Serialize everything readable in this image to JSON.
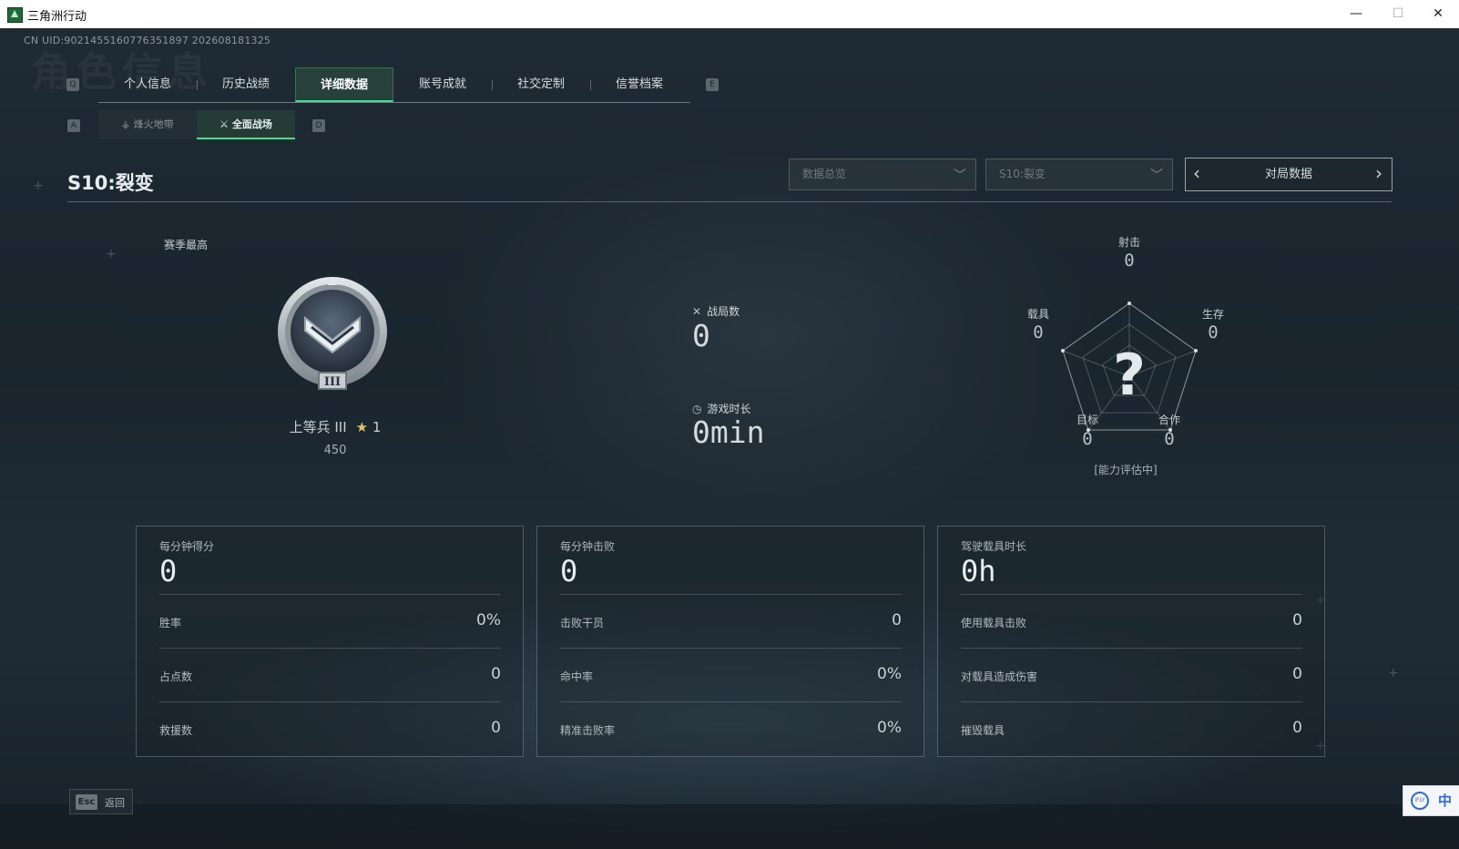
{
  "window": {
    "title": "三角洲行动",
    "minimize": "—",
    "maximize": "☐",
    "close": "✕"
  },
  "uid": "CN UID:9021455160776351897 202608181325",
  "bg_title": "角色信息",
  "tabs": {
    "key_left": "Q",
    "key_right": "E",
    "items": [
      {
        "label": "个人信息"
      },
      {
        "label": "历史战绩"
      },
      {
        "label": "详细数据",
        "active": true
      },
      {
        "label": "账号成就"
      },
      {
        "label": "社交定制"
      },
      {
        "label": "信誉档案"
      }
    ]
  },
  "subtabs": {
    "key_left": "A",
    "key_right": "D",
    "items": [
      {
        "label": "烽火地带",
        "icon": "firezone-icon"
      },
      {
        "label": "全面战场",
        "icon": "battlefield-icon",
        "active": true
      }
    ]
  },
  "header": {
    "season": "S10:裂变",
    "dropdown_mode": "数据总览",
    "dropdown_season": "S10:裂变",
    "pager_label": "对局数据"
  },
  "rank": {
    "season_best": "赛季最高",
    "name": "上等兵 III",
    "stars": "1",
    "points": "450",
    "roman": "III"
  },
  "stats": {
    "matches_label": "战局数",
    "matches_value": "0",
    "time_label": "游戏时长",
    "time_value": "0min"
  },
  "radar": {
    "shoot": {
      "label": "射击",
      "value": "0"
    },
    "survive": {
      "label": "生存",
      "value": "0"
    },
    "coop": {
      "label": "合作",
      "value": "0"
    },
    "target": {
      "label": "目标",
      "value": "0"
    },
    "vehicle": {
      "label": "载具",
      "value": "0"
    },
    "unknown_mark": "?",
    "assessing": "[能力评估中]"
  },
  "cards": [
    {
      "head_label": "每分钟得分",
      "head_value": "0",
      "rows": [
        {
          "k": "胜率",
          "v": "0%"
        },
        {
          "k": "占点数",
          "v": "0"
        },
        {
          "k": "救援数",
          "v": "0"
        }
      ]
    },
    {
      "head_label": "每分钟击败",
      "head_value": "0",
      "rows": [
        {
          "k": "击败干员",
          "v": "0"
        },
        {
          "k": "命中率",
          "v": "0%"
        },
        {
          "k": "精准击败率",
          "v": "0%"
        }
      ]
    },
    {
      "head_label": "驾驶载具时长",
      "head_value": "0h",
      "rows": [
        {
          "k": "使用载具击败",
          "v": "0"
        },
        {
          "k": "对载具造成伤害",
          "v": "0"
        },
        {
          "k": "摧毁载具",
          "v": "0"
        }
      ]
    }
  ],
  "footer": {
    "esc_key": "Esc",
    "back_label": "返回"
  },
  "ime": {
    "brand": "iFLY",
    "mode": "中"
  },
  "colors": {
    "accent": "#3fe08a",
    "star": "#e3c45a"
  }
}
